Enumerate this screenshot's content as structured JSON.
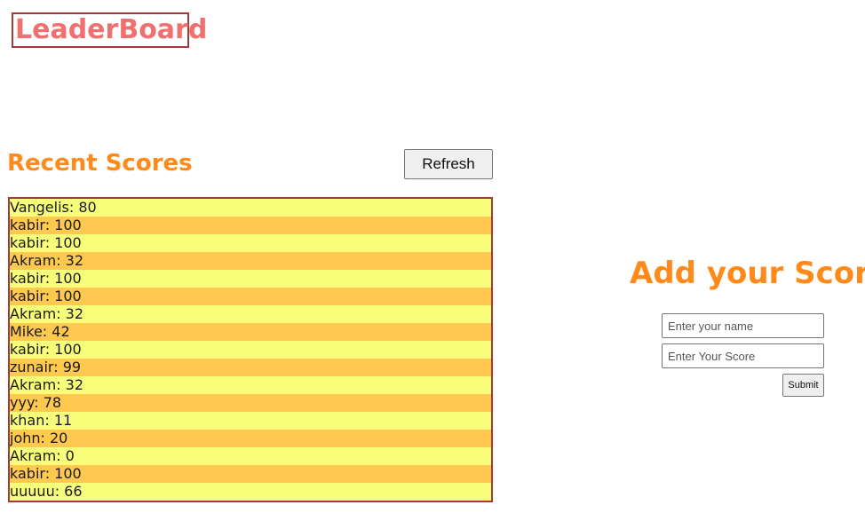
{
  "header": {
    "title": "LeaderBoard"
  },
  "recent": {
    "title": "Recent Scores",
    "refresh_label": "Refresh",
    "scores": [
      "Vangelis: 80",
      "kabir: 100",
      "kabir: 100",
      "Akram: 32",
      "kabir: 100",
      "kabir: 100",
      "Akram: 32",
      "Mike: 42",
      "kabir: 100",
      "zunair: 99",
      "Akram: 32",
      "yyy: 78",
      "khan: 11",
      "john: 20",
      "Akram: 0",
      "kabir: 100",
      "uuuuu: 66"
    ]
  },
  "form": {
    "title": "Add your Score",
    "name_placeholder": "Enter your name",
    "name_value": "",
    "score_placeholder": "Enter Your Score",
    "score_value": "",
    "submit_label": "Submit"
  },
  "colors": {
    "title_text": "#f07070",
    "title_border": "#a33a3a",
    "accent_orange": "#ff8a1a",
    "row_odd": "#f7ff7a",
    "row_even": "#ffc84f"
  }
}
